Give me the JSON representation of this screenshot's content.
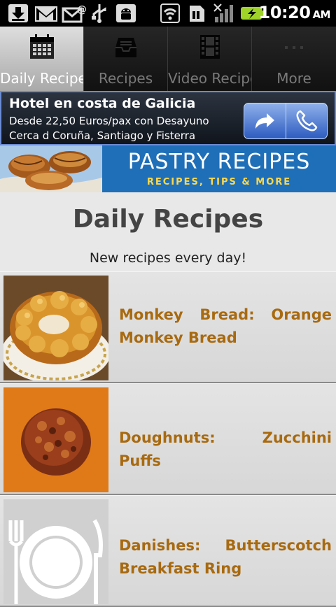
{
  "status": {
    "time": "10:20",
    "ampm": "AM",
    "icons": [
      "download-icon",
      "gmail-icon",
      "email-icon",
      "usb-icon",
      "android-debug-icon",
      "wifi-icon",
      "sim-icon",
      "signal-icon",
      "battery-charging-icon"
    ]
  },
  "tabs": [
    {
      "label": "Daily Recipes",
      "icon": "calendar-icon",
      "active": true
    },
    {
      "label": "Recipes",
      "icon": "inbox-icon",
      "active": false
    },
    {
      "label": "Video Recipe",
      "icon": "film-icon",
      "active": false
    },
    {
      "label": "More",
      "icon": "more-dots-icon",
      "active": false
    }
  ],
  "ad": {
    "title": "Hotel en costa de Galicia",
    "line1": "Desde 22,50 Euros/pax con Desayuno",
    "line2": "Cerca d Coruña, Santiago y Fisterra",
    "buttons": [
      "share-arrow-icon",
      "phone-icon"
    ]
  },
  "pastry_banner": {
    "title": "PASTRY RECIPES",
    "subtitle": "RECIPES, TIPS & MORE"
  },
  "page": {
    "title": "Daily Recipes",
    "subtitle": "New recipes every day!"
  },
  "recipes": [
    {
      "title": "Monkey Bread: Orange Monkey Bread"
    },
    {
      "title": "Doughnuts: Zucchini Puffs"
    },
    {
      "title": "Danishes: Butterscotch Breakfast Ring"
    }
  ],
  "colors": {
    "accent_text": "#a86a10",
    "tab_active": "#c8c8c8",
    "ad_border": "#6a8bd4",
    "pastry_blue": "#1f6fb8"
  }
}
